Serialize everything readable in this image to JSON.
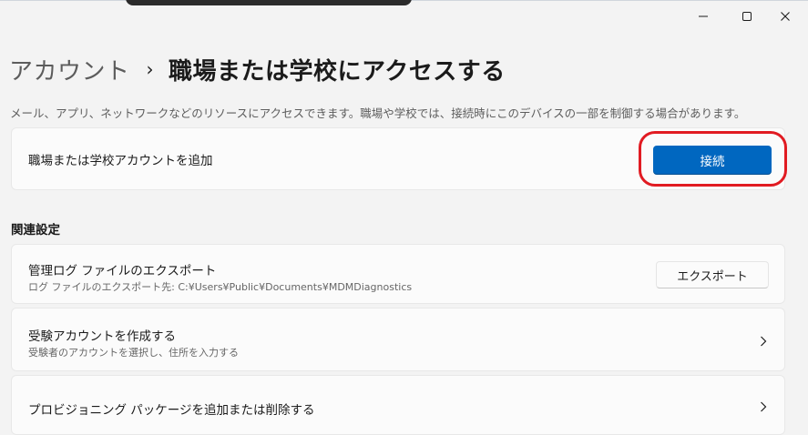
{
  "window": {
    "minimize_icon": "minimize-icon",
    "maximize_icon": "maximize-icon",
    "close_icon": "close-icon"
  },
  "breadcrumb": {
    "parent": "アカウント",
    "separator": "›",
    "current": "職場または学校にアクセスする"
  },
  "description": "メール、アプリ、ネットワークなどのリソースにアクセスできます。職場や学校では、接続時にこのデバイスの一部を制御する場合があります。",
  "add_account": {
    "title": "職場または学校アカウントを追加",
    "button_label": "接続",
    "button_color": "#0067c0",
    "highlight_color": "#e11b22"
  },
  "related_settings": {
    "heading": "関連設定",
    "items": [
      {
        "title": "管理ログ ファイルのエクスポート",
        "subtitle": "ログ ファイルのエクスポート先: C:¥Users¥Public¥Documents¥MDMDiagnostics",
        "action_label": "エクスポート"
      },
      {
        "title": "受験アカウントを作成する",
        "subtitle": "受験者のアカウントを選択し、住所を入力する",
        "icon": "chevron-right-icon"
      },
      {
        "title": "プロビジョニング パッケージを追加または削除する",
        "icon": "chevron-right-icon"
      }
    ]
  }
}
